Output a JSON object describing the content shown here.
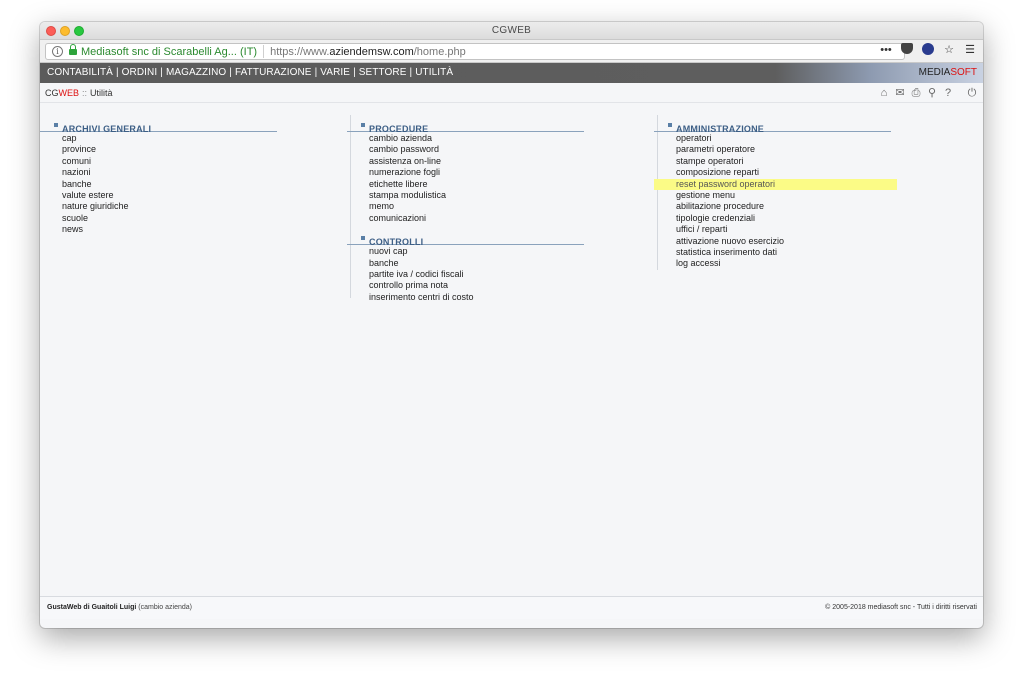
{
  "window": {
    "title": "CGWEB"
  },
  "browser": {
    "site_identity": "Mediasoft snc di Scarabelli Ag... (IT)",
    "url_prefix": "https://www.",
    "url_domain": "aziendemsw.com",
    "url_path": "/home.php",
    "icons": [
      "more-icon",
      "pocket-icon",
      "ublock-icon",
      "bookmark-star-icon",
      "hamburger-menu-icon"
    ]
  },
  "navbar": {
    "menu": [
      "CONTABILITÀ",
      "ORDINI",
      "MAGAZZINO",
      "FATTURAZIONE",
      "VARIE",
      "SETTORE",
      "UTILITÀ"
    ],
    "separator": "|",
    "brand_part1": "MEDIA",
    "brand_part2": "SOFT"
  },
  "breadcrumb": {
    "app_part1": "CG",
    "app_part2": "WEB",
    "separator": "::",
    "current": "Utilità",
    "icons": [
      "home-icon",
      "mail-icon",
      "print-icon",
      "search-icon",
      "help-icon",
      "power-icon"
    ]
  },
  "columns": [
    {
      "sections": [
        {
          "title": "ARCHIVI GENERALI",
          "items": [
            "cap",
            "province",
            "comuni",
            "nazioni",
            "banche",
            "valute estere",
            "nature giuridiche",
            "scuole",
            "news"
          ]
        }
      ]
    },
    {
      "sections": [
        {
          "title": "PROCEDURE",
          "items": [
            "cambio azienda",
            "cambio password",
            "assistenza on-line",
            "numerazione fogli",
            "etichette libere",
            "stampa modulistica",
            "memo",
            "comunicazioni"
          ]
        },
        {
          "title": "CONTROLLI",
          "items": [
            "nuovi cap",
            "banche",
            "partite iva / codici fiscali",
            "controllo prima nota",
            "inserimento centri di costo"
          ]
        }
      ]
    },
    {
      "sections": [
        {
          "title": "AMMINISTRAZIONE",
          "items": [
            "operatori",
            "parametri operatore",
            "stampe operatori",
            "composizione reparti",
            "reset password operatori",
            "gestione menu",
            "abilitazione procedure",
            "tipologie credenziali",
            "uffici / reparti",
            "attivazione nuovo esercizio",
            "statistica inserimento dati",
            "log accessi"
          ],
          "highlighted_item": "reset password operatori"
        }
      ]
    }
  ],
  "footer": {
    "user": "GustaWeb di Guaitoli Luigi",
    "change_link": "(cambio azienda)",
    "copyright": "© 2005-2018 mediasoft snc - Tutti i diritti riservati"
  },
  "colors": {
    "highlight": "#fbfb86",
    "section_title": "#3d5f86",
    "brand_red": "#dd1111",
    "site_identity_green": "#2b8a2f"
  }
}
